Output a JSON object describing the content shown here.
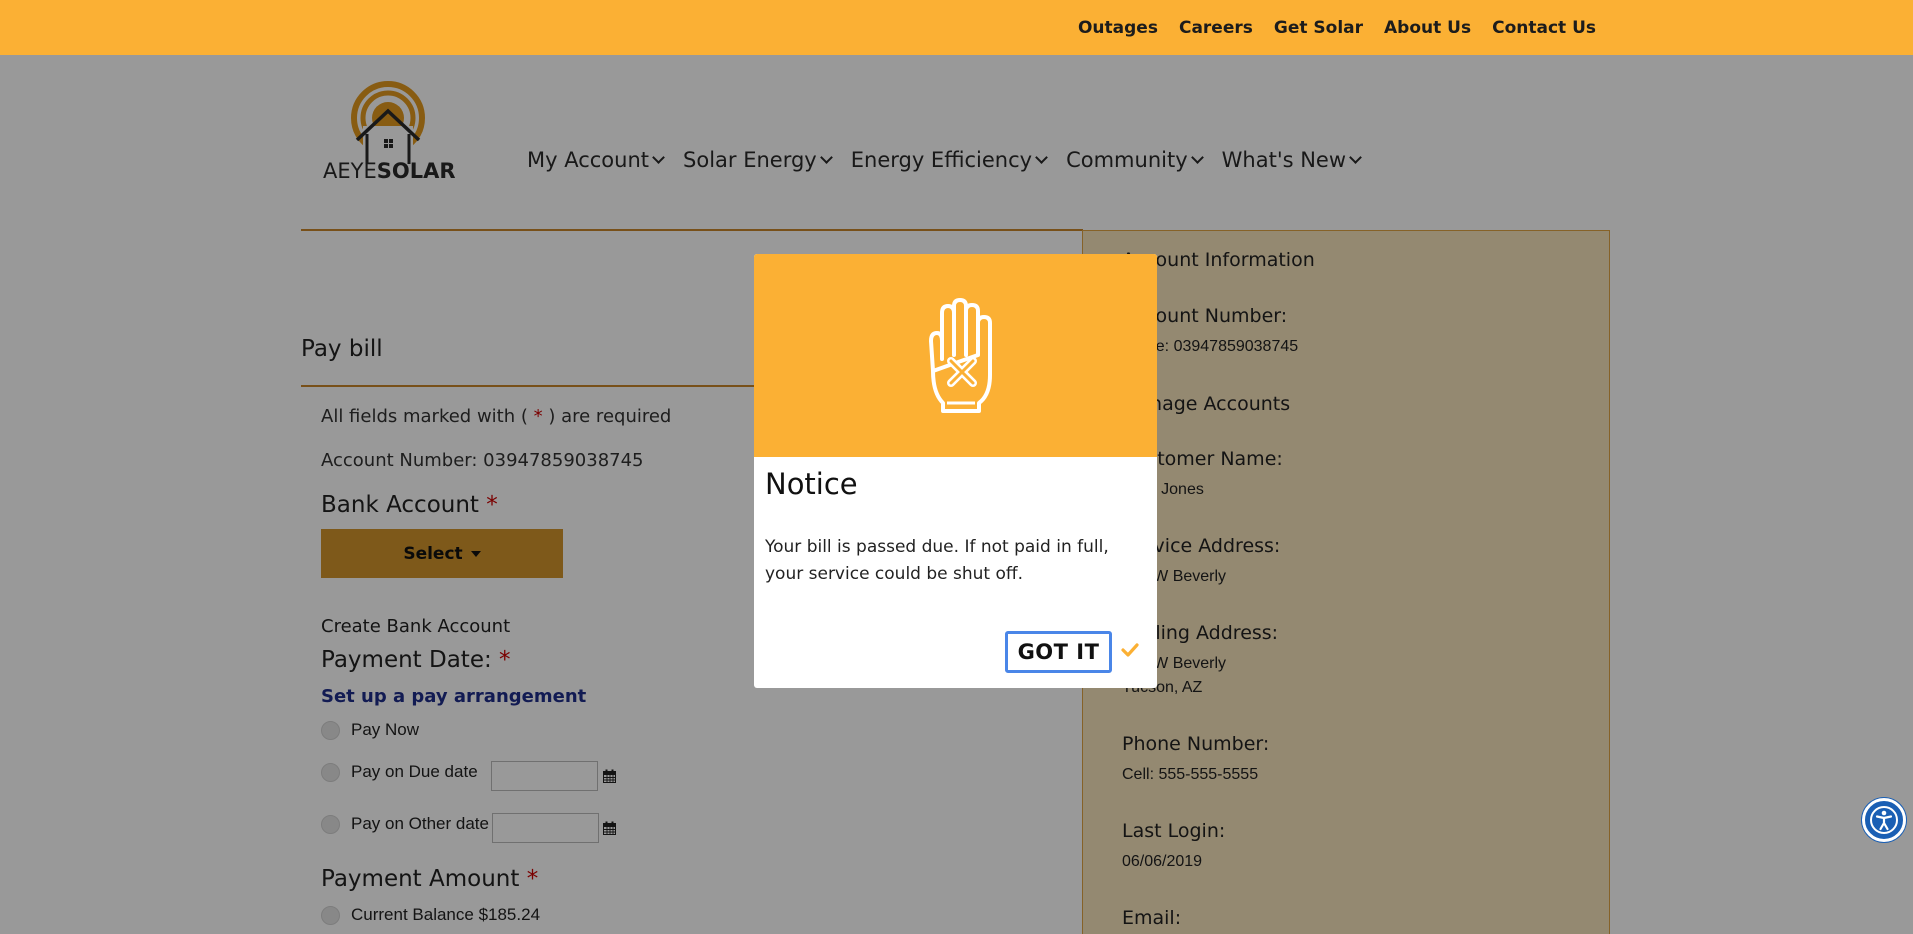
{
  "colors": {
    "accent": "#fbb034",
    "select_button": "#d3952c",
    "link_blue": "#1f2d8a",
    "required": "#cc0000",
    "focus_blue": "#4a86e8",
    "a11y_blue": "#1a5fb4"
  },
  "topnav": {
    "items": [
      "Outages",
      "Careers",
      "Get Solar",
      "About Us",
      "Contact Us"
    ]
  },
  "brand": {
    "part1": "AEYE",
    "part2": "SOLAR"
  },
  "mainnav": {
    "items": [
      "My Account",
      "Solar Energy",
      "Energy Efficiency",
      "Community",
      "What's New"
    ]
  },
  "paybill": {
    "title": "Pay bill",
    "required_prefix": "All fields marked with (",
    "required_star": "*",
    "required_suffix": ") are required",
    "account_number": "Account Number: 03947859038745",
    "bank_account_label": "Bank Account",
    "select_label": "Select",
    "create_bank": "Create Bank Account",
    "payment_date_label": "Payment Date:",
    "arrangement_link": "Set up a pay arrangement",
    "pay_now": "Pay Now",
    "pay_due": "Pay on Due date",
    "pay_other": "Pay on Other date",
    "payment_amount_label": "Payment Amount",
    "current_balance": "Current Balance $185.24"
  },
  "sidebar": {
    "title": "Account Information",
    "account_number_label": "Account Number:",
    "account_number_value": "Home: 03947859038745",
    "manage_accounts": "Manage Accounts",
    "customer_name_label": "Customer Name:",
    "customer_name_value": "Jane Jones",
    "service_address_label": "Service Address:",
    "service_address_value": "123 W Beverly",
    "mailing_address_label": "Mailing Address:",
    "mailing_address_line1": "123 W Beverly",
    "mailing_address_line2": "Tucson, AZ",
    "phone_label": "Phone Number:",
    "phone_value": "Cell: 555-555-5555",
    "last_login_label": "Last Login:",
    "last_login_value": "06/06/2019",
    "email_label": "Email:"
  },
  "modal": {
    "icon": "stop-hand-icon",
    "title": "Notice",
    "message": "Your bill is passed due. If not paid in full, your service could be shut off.",
    "button_label": "GOT IT"
  },
  "icons": {
    "calendar": "calendar-icon",
    "check": "checkmark-icon",
    "accessibility": "accessibility-icon",
    "dropdown": "chevron-down-icon"
  }
}
